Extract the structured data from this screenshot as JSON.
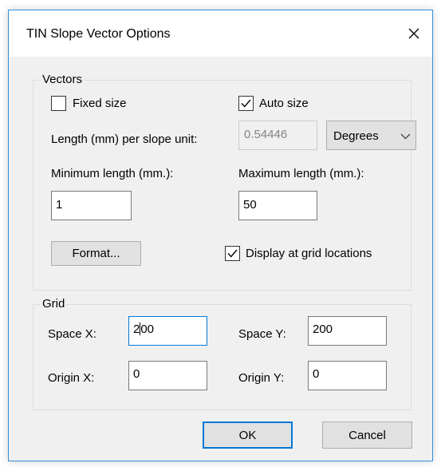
{
  "window": {
    "title": "TIN Slope Vector Options",
    "close_glyph": "✕"
  },
  "vectors": {
    "group_label": "Vectors",
    "fixed_size_label": "Fixed size",
    "fixed_size_checked": false,
    "auto_size_label": "Auto size",
    "auto_size_checked": true,
    "length_label": "Length (mm) per slope unit:",
    "length_value": "0.54446",
    "unit_selected": "Degrees",
    "min_length_label": "Minimum length (mm.):",
    "min_length_value": "1",
    "max_length_label": "Maximum length (mm.):",
    "max_length_value": "50",
    "format_button": "Format...",
    "display_grid_label": "Display at grid locations",
    "display_grid_checked": true
  },
  "grid": {
    "group_label": "Grid",
    "space_x_label": "Space X:",
    "space_x_value_before_caret": "2",
    "space_x_value_after_caret": "00",
    "space_y_label": "Space Y:",
    "space_y_value": "200",
    "origin_x_label": "Origin X:",
    "origin_x_value": "0",
    "origin_y_label": "Origin Y:",
    "origin_y_value": "0"
  },
  "buttons": {
    "ok": "OK",
    "cancel": "Cancel"
  },
  "icons": {
    "close": "close-icon",
    "check": "checkmark-icon",
    "dropdown": "chevron-down-icon"
  },
  "colors": {
    "dialog_bg": "#f0f0f0",
    "accent": "#0078d7",
    "disabled_text": "#838383"
  }
}
